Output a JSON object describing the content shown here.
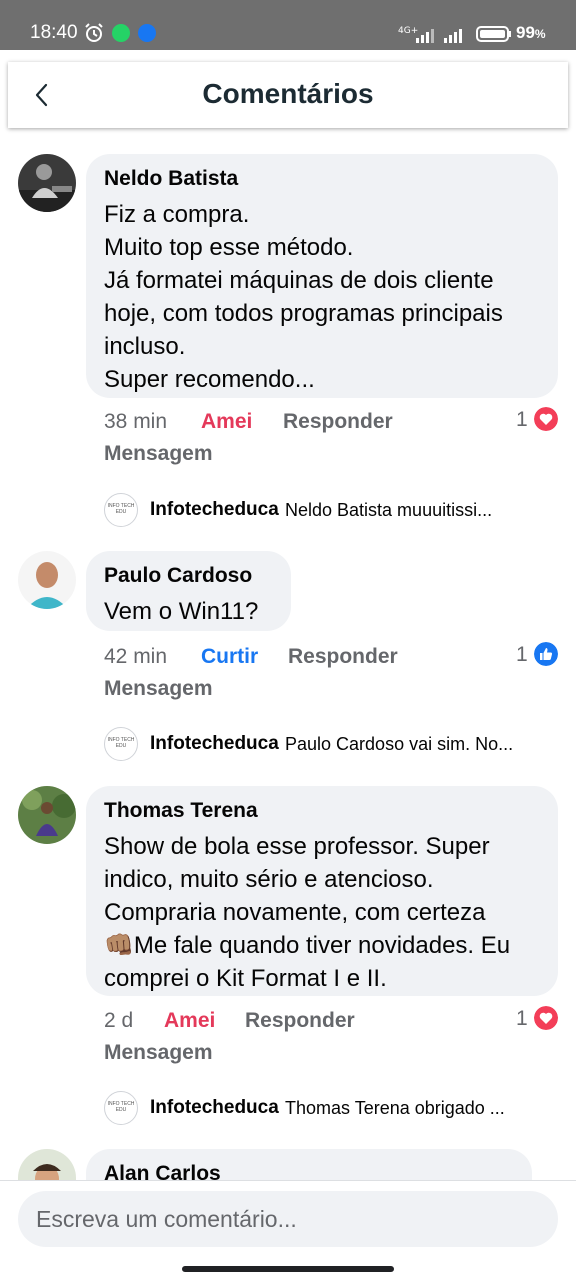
{
  "status_bar": {
    "time": "18:40",
    "battery": "99",
    "battery_unit": "%",
    "network": "4G+"
  },
  "header": {
    "title": "Comentários"
  },
  "comments": [
    {
      "author": "Neldo Batista",
      "lines": [
        "Fiz a compra.",
        "Muito top esse método.",
        "Já formatei máquinas de dois cliente",
        "hoje, com todos programas principais",
        "incluso.",
        "Super recomendo..."
      ],
      "time": "38 min",
      "reaction_action": "Amei",
      "reply_label": "Responder",
      "message_label": "Mensagem",
      "reaction_count": "1",
      "reaction_type": "love",
      "reply": {
        "author": "Infotecheduca",
        "text": "Neldo Batista muuuitissi..."
      }
    },
    {
      "author": "Paulo Cardoso",
      "lines": [
        "Vem o Win11?"
      ],
      "time": "42 min",
      "reaction_action": "Curtir",
      "reply_label": "Responder",
      "message_label": "Mensagem",
      "reaction_count": "1",
      "reaction_type": "like",
      "reply": {
        "author": "Infotecheduca",
        "text": "Paulo Cardoso vai sim. No..."
      }
    },
    {
      "author": "Thomas Terena",
      "lines": [
        "Show de bola esse professor. Super",
        "indico, muito sério e atencioso.",
        "Compraria novamente, com certeza",
        "👊🏽Me fale quando tiver novidades. Eu",
        "comprei o Kit Format I e II."
      ],
      "time": "2 d",
      "reaction_action": "Amei",
      "reply_label": "Responder",
      "message_label": "Mensagem",
      "reaction_count": "1",
      "reaction_type": "love",
      "reply": {
        "author": "Infotecheduca",
        "text": "Thomas Terena obrigado ..."
      }
    },
    {
      "author": "Alan Carlos"
    }
  ],
  "reply_avatar_text": "INFO TECH EDU",
  "composer": {
    "placeholder": "Escreva um comentário..."
  },
  "colors": {
    "love": "#f33e58",
    "like": "#1877f2",
    "bubble": "#f0f2f5",
    "meta": "#65676b"
  }
}
